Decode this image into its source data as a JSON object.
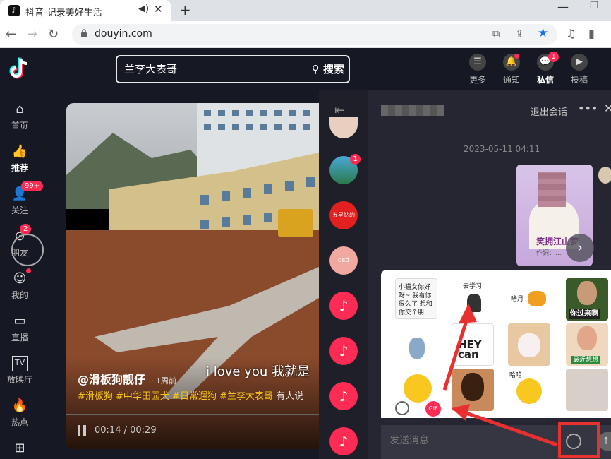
{
  "browser": {
    "tab_title": "抖音-记录美好生活",
    "tab_favicon": "♪",
    "url": "douyin.com"
  },
  "sidebar": {
    "items": [
      {
        "label": "首页",
        "icon": "⌂"
      },
      {
        "label": "推荐",
        "icon": "👍"
      },
      {
        "label": "关注",
        "icon": "👤",
        "badge": "99+"
      },
      {
        "label": "朋友",
        "icon": "⊙",
        "badge": "2"
      },
      {
        "label": "我的",
        "icon": "☺"
      },
      {
        "label": "直播",
        "icon": "▭"
      },
      {
        "label": "放映厅",
        "icon": "TV"
      },
      {
        "label": "热点",
        "icon": "🔥"
      }
    ]
  },
  "header": {
    "search_value": "兰李大表哥",
    "search_button": "搜索",
    "items": [
      {
        "label": "更多",
        "icon": "☰"
      },
      {
        "label": "通知",
        "icon": "🔔"
      },
      {
        "label": "私信",
        "icon": "💬",
        "badge": "1"
      },
      {
        "label": "投稿",
        "icon": "▶"
      }
    ]
  },
  "video": {
    "author": "@滑板狗靓仔",
    "posted": "· 1周前",
    "subtitle": "i love you 我就是",
    "tags": "#滑板狗  #中华田园犬  #日常遛狗  #兰李大表哥",
    "tags_more": "有人说",
    "current_time": "00:14",
    "duration": "00:29",
    "time_separator": " / "
  },
  "chat": {
    "exit_label": "退出会话",
    "timestamp": "2023-05-11 04:11",
    "message_caption": "笑拥江山梦",
    "message_small": "作词：...",
    "list_badge": "1",
    "avatar_text_5star": "五星钻豹",
    "avatar_text_gsd": "gsd",
    "input_placeholder": "发送消息",
    "gif_label": "GIF",
    "stickers": {
      "s1": "小猫女你好呀~ 我看你很久了 想和你交个朋友...",
      "s2": "去学习",
      "s3": "啥月",
      "s4": "你过来啊",
      "s5": "HEY can",
      "s6": "最近想想",
      "s7": "哈哈"
    }
  },
  "colors": {
    "accent": "#fe2c55",
    "annotation_red": "#e83030",
    "background": "#161823"
  }
}
